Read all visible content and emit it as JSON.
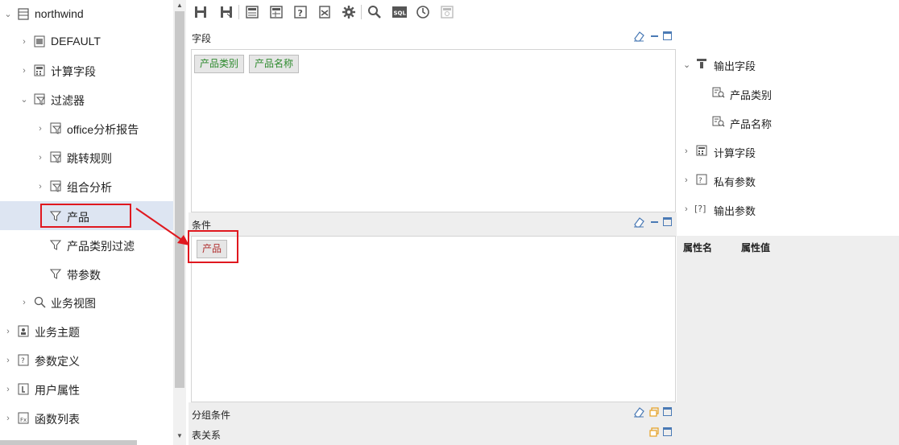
{
  "tree": {
    "items": [
      {
        "label": "northwind",
        "icon": "database-icon"
      },
      {
        "label": "DEFAULT",
        "icon": "table-icon"
      },
      {
        "label": "计算字段",
        "icon": "calculator-icon"
      },
      {
        "label": "过滤器",
        "icon": "filter-folder-icon"
      },
      {
        "label": "office分析报告",
        "icon": "filter-folder-icon"
      },
      {
        "label": "跳转规则",
        "icon": "filter-folder-icon"
      },
      {
        "label": "组合分析",
        "icon": "filter-folder-icon"
      },
      {
        "label": "产品",
        "icon": "filter-icon"
      },
      {
        "label": "产品类别过滤",
        "icon": "filter-icon"
      },
      {
        "label": "带参数",
        "icon": "filter-icon"
      },
      {
        "label": "业务视图",
        "icon": "search-icon"
      },
      {
        "label": "业务主题",
        "icon": "theme-icon"
      },
      {
        "label": "参数定义",
        "icon": "parameter-icon"
      },
      {
        "label": "用户属性",
        "icon": "user-attr-icon"
      },
      {
        "label": "函数列表",
        "icon": "function-icon"
      }
    ]
  },
  "toolbar": {
    "buttons": [
      "save-icon",
      "save-as-icon",
      "layout-icon",
      "layout-grid-icon",
      "help-icon",
      "export-icon",
      "settings-icon",
      "search-icon",
      "sql-icon",
      "clock-icon",
      "disabled-icon"
    ],
    "sql_label": "SQL"
  },
  "panes": {
    "fields": {
      "title": "字段",
      "chips": [
        "产品类别",
        "产品名称"
      ]
    },
    "conditions": {
      "title": "条件",
      "chips": [
        "产品"
      ]
    },
    "group_conditions": {
      "title": "分组条件"
    },
    "table_relations": {
      "title": "表关系"
    }
  },
  "right_panel": {
    "items": [
      {
        "label": "输出字段",
        "icon": "output-fields-icon",
        "expanded": true
      },
      {
        "label": "产品类别",
        "icon": "field-search-icon"
      },
      {
        "label": "产品名称",
        "icon": "field-search-icon"
      },
      {
        "label": "计算字段",
        "icon": "calculator-icon"
      },
      {
        "label": "私有参数",
        "icon": "private-param-icon"
      },
      {
        "label": "输出参数",
        "icon": "output-param-icon"
      }
    ]
  },
  "properties": {
    "name_header": "属性名",
    "value_header": "属性值"
  },
  "colors": {
    "selection": "#dde5f2",
    "annotation": "#e0181f",
    "chip_green": "#2e8b2e",
    "chip_red": "#b03030"
  }
}
